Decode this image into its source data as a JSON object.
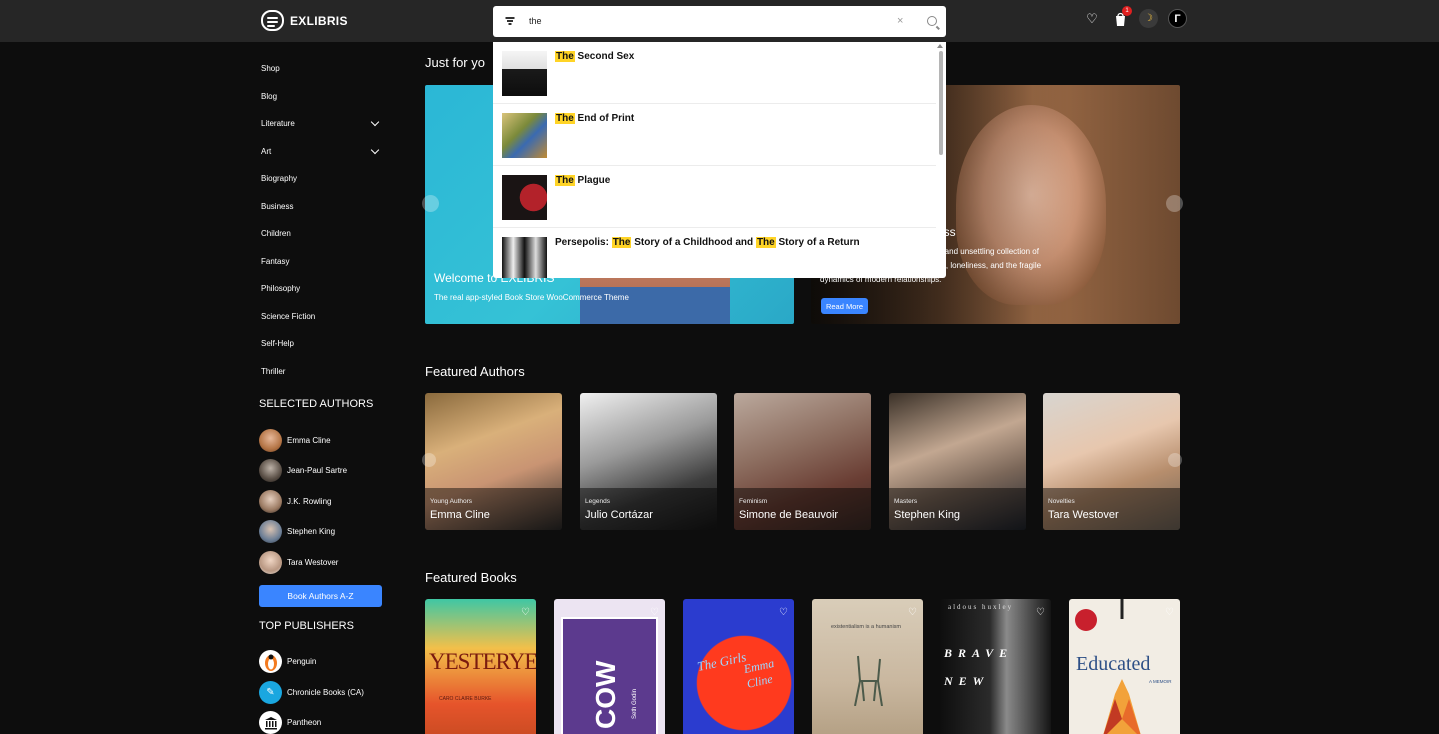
{
  "header": {
    "logo_text": "EXLIBRIS",
    "search_value": "the",
    "clear_glyph": "×",
    "cart_count": "1",
    "account_initial": "Г"
  },
  "sidebar": {
    "categories": [
      {
        "label": "Shop",
        "has_children": false
      },
      {
        "label": "Blog",
        "has_children": false
      },
      {
        "label": "Literature",
        "has_children": true
      },
      {
        "label": "Art",
        "has_children": true
      },
      {
        "label": "Biography",
        "has_children": false
      },
      {
        "label": "Business",
        "has_children": false
      },
      {
        "label": "Children",
        "has_children": false
      },
      {
        "label": "Fantasy",
        "has_children": false
      },
      {
        "label": "Philosophy",
        "has_children": false
      },
      {
        "label": "Science Fiction",
        "has_children": false
      },
      {
        "label": "Self-Help",
        "has_children": false
      },
      {
        "label": "Thriller",
        "has_children": false
      }
    ],
    "selected_authors_title": "SELECTED AUTHORS",
    "authors": [
      "Emma Cline",
      "Jean-Paul Sartre",
      "J.K. Rowling",
      "Stephen King",
      "Tara Westover"
    ],
    "authors_button": "Book Authors A-Z",
    "publishers_title": "TOP PUBLISHERS",
    "publishers": [
      "Penguin",
      "Chronicle Books (CA)",
      "Pantheon"
    ]
  },
  "main": {
    "just_for_you_title": "Just for yo",
    "hero1": {
      "title": "Welcome to EXLIBRIS",
      "subtitle": "The real app-styled Book Store WooCommerce Theme"
    },
    "hero2": {
      "title_fragment": "ess",
      "subtitle_lines": [
        "p and unsettling collection of",
        "ire, loneliness, and the fragile",
        "dynamics of modern relationships."
      ],
      "button": "Read More"
    },
    "featured_authors_title": "Featured Authors",
    "featured_authors": [
      {
        "tag": "Young Authors",
        "name": "Emma Cline"
      },
      {
        "tag": "Legends",
        "name": "Julio Cortázar"
      },
      {
        "tag": "Feminism",
        "name": "Simone de Beauvoir"
      },
      {
        "tag": "Masters",
        "name": "Stephen King"
      },
      {
        "tag": "Novelties",
        "name": "Tara Westover"
      }
    ],
    "featured_books_title": "Featured Books",
    "books": [
      {
        "cover_text": "YESTERYEAR",
        "author": "CARO CLAIRE BURKE",
        "bg": "#e6542b"
      },
      {
        "cover_text": "COW",
        "author": "Seth Godin",
        "bg": "#5c3a8e"
      },
      {
        "cover_text": "The Girls",
        "author": "Emma Cline",
        "bg": "#ff3a1e"
      },
      {
        "cover_text": "existentialism is a humanism",
        "author": "",
        "bg": "#c9b79f"
      },
      {
        "cover_text": "BRAVE NEW",
        "author": "aldous huxley",
        "bg": "#1c1c1c"
      },
      {
        "cover_text": "Educated",
        "author": "A MEMOIR",
        "bg": "#f2ede4"
      }
    ]
  },
  "search_results": [
    {
      "highlight": "The",
      "rest": " Second Sex"
    },
    {
      "highlight": "The",
      "rest": " End of Print"
    },
    {
      "highlight": "The",
      "rest": " Plague"
    },
    {
      "prefix": "Persepolis: ",
      "highlight": "The",
      "middle": " Story of a Childhood and ",
      "highlight2": "The",
      "rest": " Story of a Return"
    }
  ],
  "colors": {
    "accent": "#3a85ff",
    "highlight": "#ffd426",
    "header_bg": "#262626",
    "page_bg": "#0d0d0d"
  }
}
